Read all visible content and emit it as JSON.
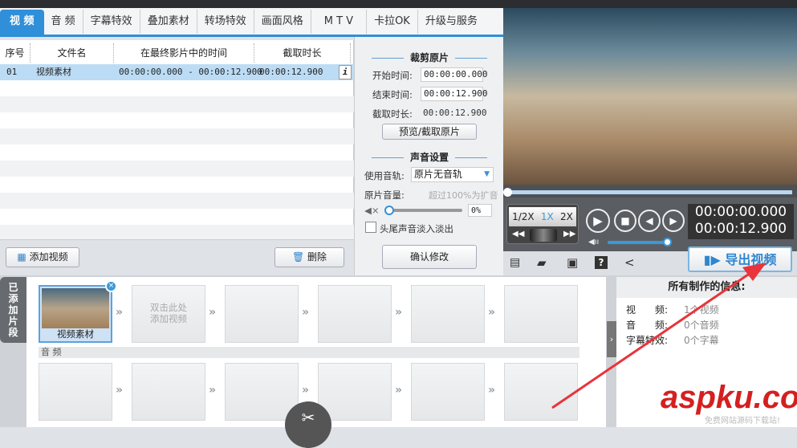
{
  "tabs": [
    "视 频",
    "音 频",
    "字幕特效",
    "叠加素材",
    "转场特效",
    "画面风格",
    "M T V",
    "卡拉OK",
    "升级与服务"
  ],
  "table": {
    "headers": [
      "序号",
      "文件名",
      "在最终影片中的时间",
      "截取时长"
    ],
    "rows": [
      {
        "index": "01",
        "name": "视频素材",
        "time": "00:00:00.000 - 00:00:12.900",
        "duration": "00:00:12.900"
      }
    ],
    "info_icon": "i"
  },
  "trim": {
    "title": "裁剪原片",
    "start_label": "开始时间:",
    "start": "00:00:00.000",
    "end_label": "结束时间:",
    "end": "00:00:12.900",
    "dur_label": "截取时长:",
    "dur": "00:00:12.900",
    "preview_btn": "预览/截取原片"
  },
  "sound": {
    "title": "声音设置",
    "track_label": "使用音轨:",
    "track": "原片无音轨",
    "vol_label": "原片音量:",
    "vol_hint": "超过100%为扩音",
    "vol": "0%",
    "fade": "头尾声音淡入淡出",
    "confirm": "确认修改"
  },
  "player": {
    "speeds": [
      "1/2X",
      "1X",
      "2X"
    ],
    "time_current": "00:00:00.000",
    "time_total": "00:00:12.900",
    "export": "导出视频",
    "volume": 0.9
  },
  "buttons": {
    "add": "添加视频",
    "delete": "删除"
  },
  "clips": {
    "tab": "已添加片段",
    "first": "视频素材",
    "hint": "双击此处\n添加视频",
    "audio_label": "音 频"
  },
  "info": {
    "title": "所有制作的信息:",
    "rows": [
      [
        "视　　频:",
        "1个视频"
      ],
      [
        "音　　频:",
        "0个音频"
      ],
      [
        "字幕特效:",
        "0个字幕"
      ]
    ]
  },
  "watermark": {
    "brand": "aspku.com",
    "sub": "免费网站源码下载站!"
  }
}
